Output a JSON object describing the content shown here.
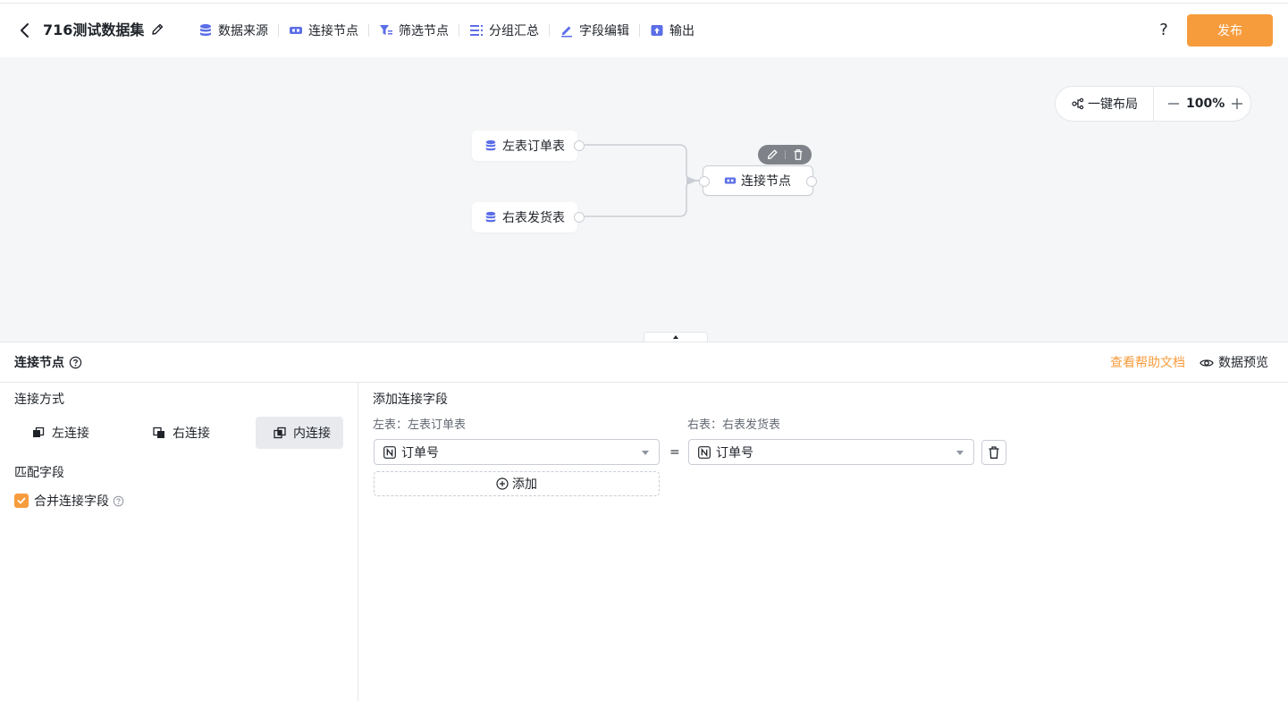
{
  "header": {
    "title": "716测试数据集",
    "tools": [
      {
        "label": "数据来源",
        "icon": "database-icon"
      },
      {
        "label": "连接节点",
        "icon": "join-icon"
      },
      {
        "label": "筛选节点",
        "icon": "filter-icon"
      },
      {
        "label": "分组汇总",
        "icon": "group-icon"
      },
      {
        "label": "字段编辑",
        "icon": "edit-field-icon"
      },
      {
        "label": "输出",
        "icon": "output-icon"
      }
    ],
    "help": "?",
    "publish_label": "发布"
  },
  "canvas": {
    "auto_layout_label": "一键布局",
    "zoom": "100%",
    "nodes": {
      "left": "左表订单表",
      "right": "右表发货表",
      "join": "连接节点"
    }
  },
  "panel": {
    "title": "连接节点",
    "help_doc": "查看帮助文档",
    "preview": "数据预览",
    "join_method_label": "连接方式",
    "join_types": [
      "左连接",
      "右连接",
      "内连接"
    ],
    "active_join": "内连接",
    "match_fields_label": "匹配字段",
    "merge_label": "合并连接字段",
    "merge_checked": true,
    "add_fields_label": "添加连接字段",
    "left_table_label": "左表：左表订单表",
    "right_table_label": "右表：右表发货表",
    "left_field": "订单号",
    "right_field": "订单号",
    "equals": "=",
    "add_label": "添加"
  },
  "colors": {
    "accent": "#f79c3d",
    "icon_blue": "#5b6ee8",
    "canvas_bg": "#f5f6f7"
  }
}
